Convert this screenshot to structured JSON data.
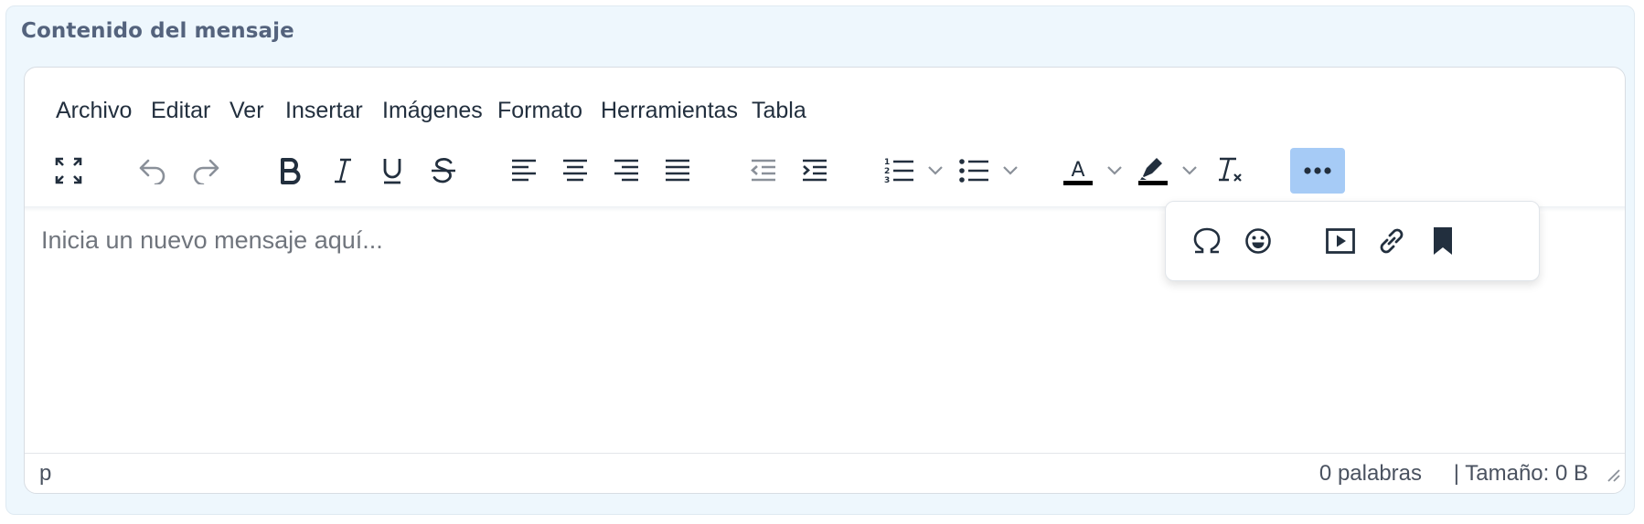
{
  "section_label": "Contenido del mensaje",
  "menubar": {
    "items": [
      "Archivo",
      "Editar",
      "Ver",
      "Insertar",
      "Imágenes",
      "Formato",
      "Herramientas",
      "Tabla"
    ]
  },
  "toolbar": {
    "buttons": [
      "fullscreen-icon",
      "undo-icon",
      "redo-icon",
      "bold-icon",
      "italic-icon",
      "underline-icon",
      "strikethrough-icon",
      "align-left-icon",
      "align-center-icon",
      "align-right-icon",
      "align-justify-icon",
      "outdent-icon",
      "indent-icon",
      "numbered-list-icon",
      "bulleted-list-icon",
      "text-color-icon",
      "highlight-color-icon",
      "clear-formatting-icon",
      "more-icon"
    ],
    "active": "more-icon",
    "text_color_letter": "A"
  },
  "overflow_toolbar": {
    "buttons": [
      "special-character-icon",
      "emoji-icon",
      "media-icon",
      "link-icon",
      "bookmark-icon"
    ]
  },
  "editor": {
    "placeholder": "Inicia un nuevo mensaje aquí..."
  },
  "statusbar": {
    "path": "p",
    "word_count": "0 palabras",
    "size": "| Tamaño: 0 B"
  },
  "colors": {
    "panel_bg": "#eef7fd",
    "active_button": "#a6cbf6",
    "icon": "#222f3e",
    "disabled_icon": "#8a9099"
  }
}
